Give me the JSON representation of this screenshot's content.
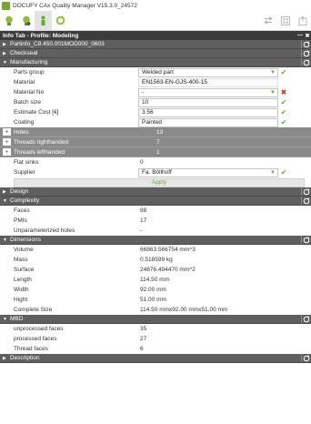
{
  "window": {
    "title": "DOCUFY CAx Quality Manager V15.3.0_24572"
  },
  "toolbar": {
    "icons": [
      "lightbulb-icon",
      "lightbulb-settings-icon",
      "person-active-icon",
      "refresh-icon"
    ],
    "right_icons": [
      "transfer-icon",
      "grid-icon",
      "export-icon"
    ]
  },
  "infobar": {
    "title": "Info Tab - Profile: Modeling",
    "minimize": "—",
    "close": "✖"
  },
  "sections": {
    "partinfo": "Partinfo_C8.450.001MOD000_0603",
    "checkseal": "Checkseal",
    "manufacturing": "Manufacturing",
    "design": "Design",
    "complexity": "Complexity",
    "dimensions": "Dimensions",
    "mbd": "MBD",
    "description": "Description"
  },
  "manufacturing": {
    "parts_group": {
      "label": "Parts group",
      "value": "Welded part"
    },
    "material": {
      "label": "Material",
      "value": "EN1563-EN-GJS-400-15"
    },
    "material_no": {
      "label": "Material No",
      "value": "-"
    },
    "batch_size": {
      "label": "Batch size",
      "value": "10"
    },
    "estimate_cost": {
      "label": "Estimate Cost [€]",
      "value": "3.56"
    },
    "coating": {
      "label": "Coating",
      "value": "Painted"
    },
    "holes": {
      "label": "Holes",
      "value": "13"
    },
    "threads_right": {
      "label": "Threads righthanded",
      "value": "7"
    },
    "threads_left": {
      "label": "Threads lefthanded",
      "value": "1"
    },
    "flat_sinks": {
      "label": "Flat sinks",
      "value": "0"
    },
    "supplier": {
      "label": "Supplier",
      "value": "Fa. Böllhoff"
    },
    "apply_label": "Apply"
  },
  "complexity": {
    "faces": {
      "label": "Faces",
      "value": "88"
    },
    "pmis": {
      "label": "PMIs",
      "value": "17"
    },
    "unparam_holes": {
      "label": "Unparameterized holes",
      "value": "-"
    }
  },
  "dimensions": {
    "volume": {
      "label": "Volume",
      "value": "66863.566754 mm^3"
    },
    "mass": {
      "label": "Mass",
      "value": "0.518599 kg"
    },
    "surface": {
      "label": "Surface",
      "value": "24876.494470 mm^2"
    },
    "length": {
      "label": "Length",
      "value": "114.50 mm"
    },
    "width": {
      "label": "Width",
      "value": "92.00 mm"
    },
    "hight": {
      "label": "Hight",
      "value": "51.00 mm"
    },
    "complete_size": {
      "label": "Complete Size",
      "value": "114.50 mmx92.00 mmx51.00 mm"
    }
  },
  "mbd": {
    "unprocessed": {
      "label": "unprocessed faces",
      "value": "35"
    },
    "processed": {
      "label": "processed faces",
      "value": "27"
    },
    "thread": {
      "label": "Thread faces",
      "value": "6"
    }
  },
  "colors": {
    "ok": "#6aab2e",
    "error": "#d0321a",
    "section": "#5f5f5f",
    "header": "#3c3c3c"
  }
}
